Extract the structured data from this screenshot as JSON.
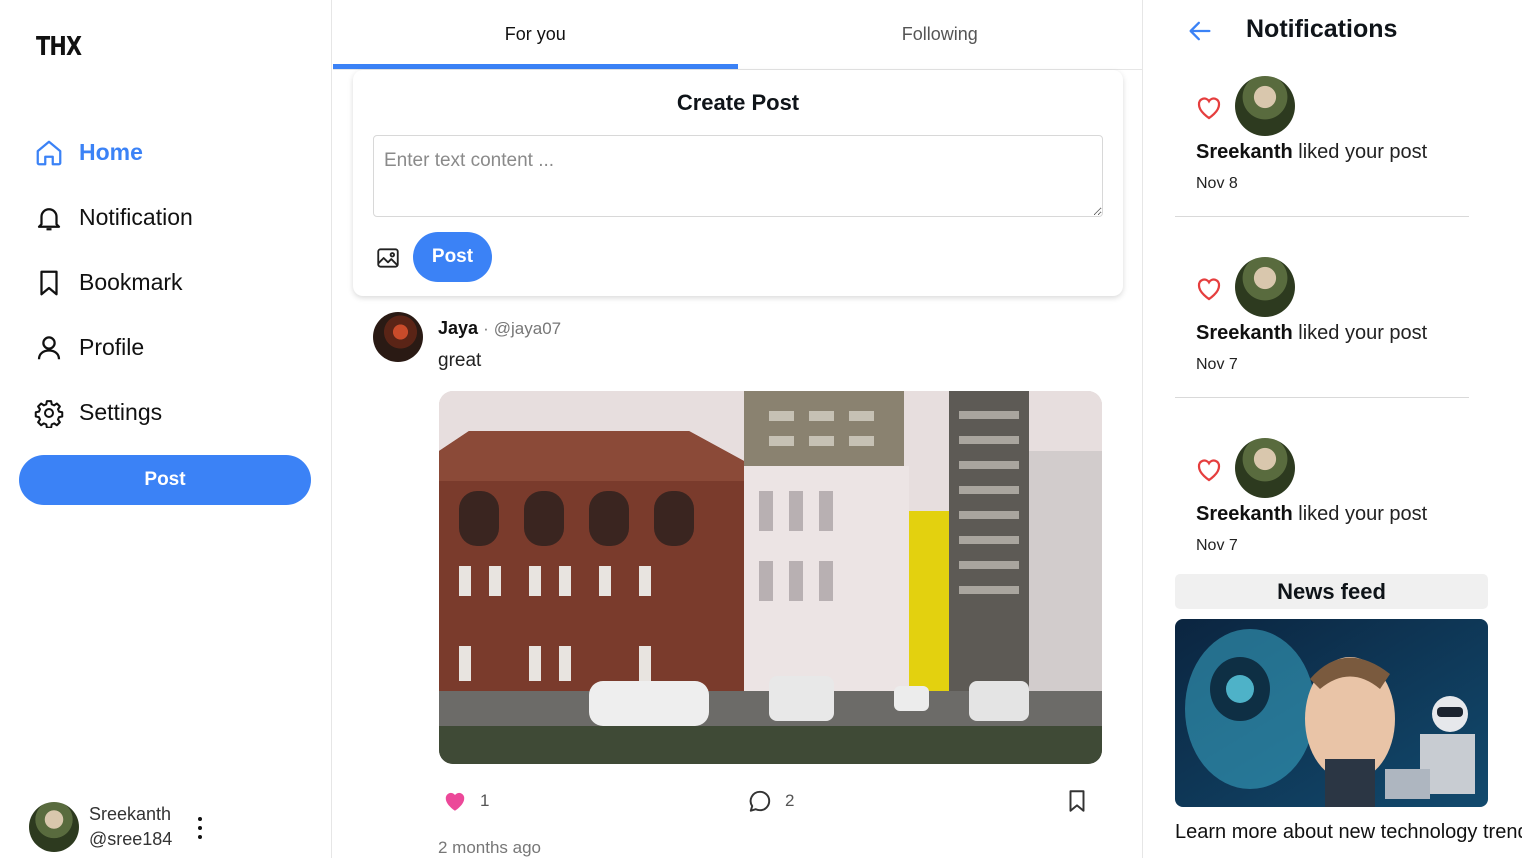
{
  "logo": "THX",
  "nav": {
    "items": [
      {
        "label": "Home",
        "icon": "home-icon"
      },
      {
        "label": "Notification",
        "icon": "bell-icon"
      },
      {
        "label": "Bookmark",
        "icon": "bookmark-icon"
      },
      {
        "label": "Profile",
        "icon": "user-icon"
      },
      {
        "label": "Settings",
        "icon": "gear-icon"
      }
    ],
    "active": "Home",
    "post_label": "Post"
  },
  "current_user": {
    "name": "Sreekanth",
    "handle": "@sree184"
  },
  "tabs": [
    {
      "label": "For you"
    },
    {
      "label": "Following"
    }
  ],
  "create_post": {
    "title": "Create Post",
    "placeholder": "Enter text content ...",
    "post_label": "Post"
  },
  "post": {
    "author": "Jaya",
    "separator": "·",
    "handle": "@jaya07",
    "text": "great",
    "likes": "1",
    "comments": "2",
    "time": "2 months ago"
  },
  "notifications": {
    "title": "Notifications",
    "items": [
      {
        "user": "Sreekanth",
        "action": "liked your post",
        "date": "Nov 8"
      },
      {
        "user": "Sreekanth",
        "action": "liked your post",
        "date": "Nov 7"
      },
      {
        "user": "Sreekanth",
        "action": "liked your post",
        "date": "Nov 7"
      }
    ]
  },
  "news": {
    "title": "News feed",
    "headline": "Learn more about new technology trends"
  },
  "colors": {
    "accent": "#3b82f6",
    "like": "#ec4899",
    "notif_heart": "#e53e3e"
  }
}
